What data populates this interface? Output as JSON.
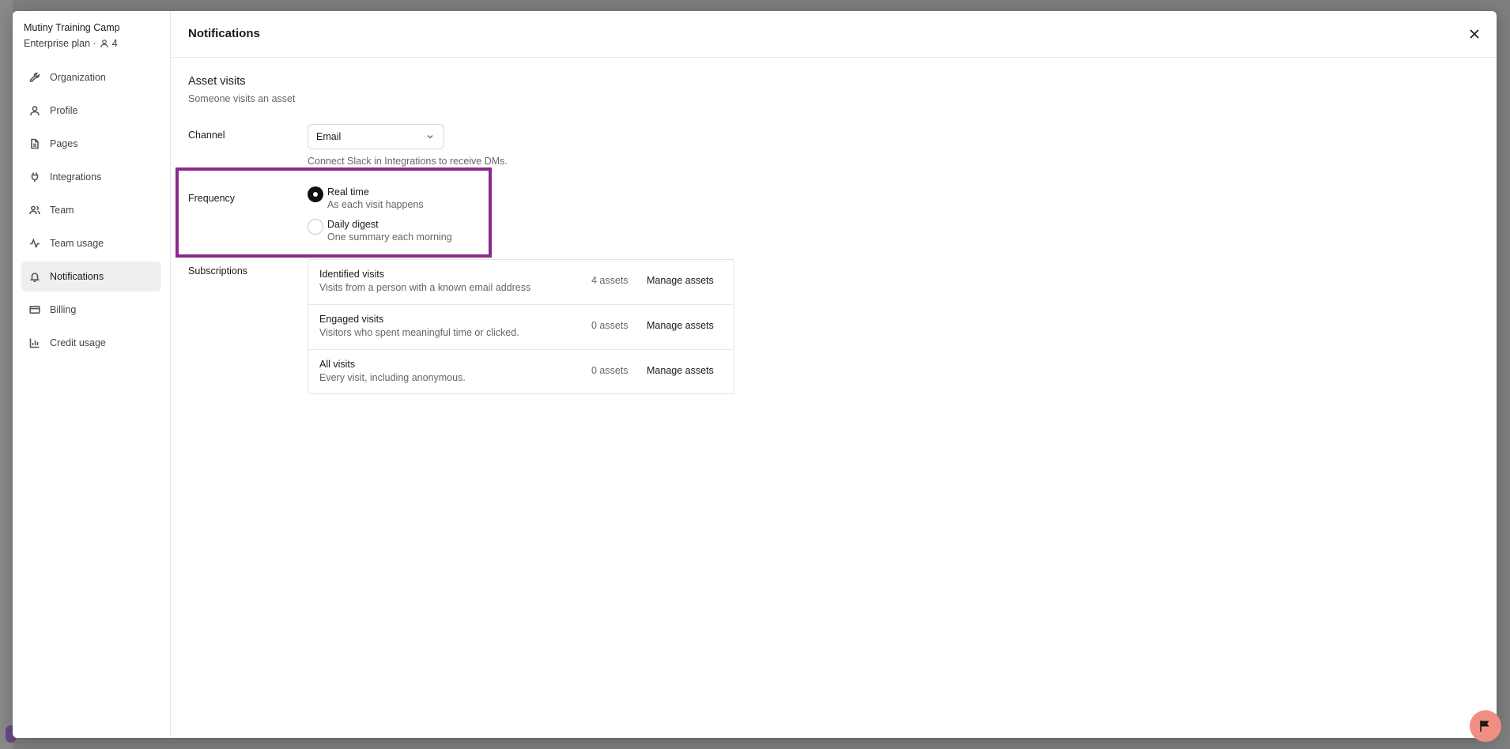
{
  "org": {
    "name": "Mutiny Training Camp",
    "plan": "Enterprise plan ·",
    "member_count": "4"
  },
  "sidebar": {
    "items": [
      {
        "label": "Organization",
        "icon": "wrench-icon"
      },
      {
        "label": "Profile",
        "icon": "user-icon"
      },
      {
        "label": "Pages",
        "icon": "page-icon"
      },
      {
        "label": "Integrations",
        "icon": "plug-icon"
      },
      {
        "label": "Team",
        "icon": "users-icon"
      },
      {
        "label": "Team usage",
        "icon": "activity-icon"
      },
      {
        "label": "Notifications",
        "icon": "bell-icon",
        "active": true
      },
      {
        "label": "Billing",
        "icon": "credit-card-icon"
      },
      {
        "label": "Credit usage",
        "icon": "bar-chart-icon"
      }
    ]
  },
  "header": {
    "title": "Notifications"
  },
  "section": {
    "title": "Asset visits",
    "subtitle": "Someone visits an asset"
  },
  "channel": {
    "label": "Channel",
    "value": "Email",
    "helper": "Connect Slack in Integrations to receive DMs."
  },
  "frequency": {
    "label": "Frequency",
    "options": [
      {
        "title": "Real time",
        "desc": "As each visit happens",
        "selected": true
      },
      {
        "title": "Daily digest",
        "desc": "One summary each morning",
        "selected": false
      }
    ]
  },
  "subscriptions": {
    "label": "Subscriptions",
    "rows": [
      {
        "title": "Identified visits",
        "desc": "Visits from a person with a known email address",
        "count": "4 assets",
        "action": "Manage assets"
      },
      {
        "title": "Engaged visits",
        "desc": "Visitors who spent meaningful time or clicked.",
        "count": "0 assets",
        "action": "Manage assets"
      },
      {
        "title": "All visits",
        "desc": "Every visit, including anonymous.",
        "count": "0 assets",
        "action": "Manage assets"
      }
    ]
  },
  "colors": {
    "highlight": "#8a2a8a",
    "help_fab": "#ef8f84",
    "active_nav_bg": "#efefef"
  }
}
